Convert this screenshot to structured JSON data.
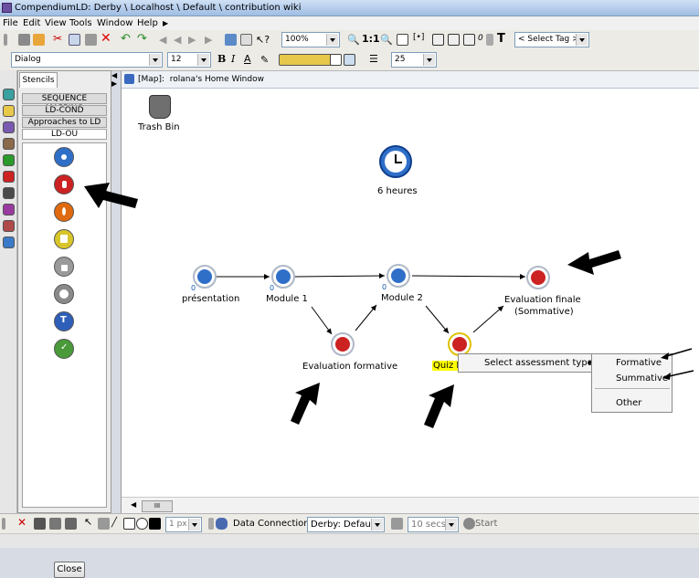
{
  "window": {
    "title": "CompendiumLD: Derby \\ Localhost \\ Default \\ contribution wiki"
  },
  "menu": [
    "File",
    "Edit",
    "View",
    "Tools",
    "Window",
    "Help"
  ],
  "toolbar": {
    "zoom": "100%",
    "zoom_actual": "1:1",
    "count": "0",
    "tag_select": "< Select Tag >",
    "font": "Dialog",
    "font_size": "12",
    "bold": "B",
    "italic": "I",
    "font_color": "A",
    "spacing": "25"
  },
  "stencils": {
    "tab": "Stencils",
    "sets": [
      "SEQUENCE MAPPING",
      "LD-COND",
      "Approaches to LD",
      "LD-OU"
    ],
    "close": "Close"
  },
  "map": {
    "title": "[Map]:  rolana's Home Window",
    "trash_label": "Trash Bin",
    "clock_label": "6 heures",
    "nodes": {
      "presentation": {
        "label": "présentation",
        "count": "0"
      },
      "module1": {
        "label": "Module 1",
        "count": "0"
      },
      "module2": {
        "label": "Module 2",
        "count": "0"
      },
      "eval_finale": {
        "label": "Evaluation finale",
        "label2": "(Sommative)"
      },
      "eval_formative": {
        "label": "Evaluation formative"
      },
      "quiz": {
        "label": "Quiz M"
      }
    },
    "scroll_label": "III"
  },
  "context_menu": {
    "item": "Select assessment type...",
    "submenu": [
      "Formative",
      "Summative",
      "Other"
    ]
  },
  "bottom": {
    "line_width": "1 px",
    "data_connection_label": "Data Connection:",
    "data_connection_value": "Derby: Default",
    "interval": "10 secs",
    "start": "Start"
  },
  "colors": {
    "blue_node": "#2f6fc8",
    "red_node": "#cc2222",
    "orange_node": "#e06a10",
    "yellow_node": "#d8c52a",
    "grey_node": "#8a8a8a",
    "green_node": "#4a9a3a",
    "highlight": "#ffff00"
  }
}
